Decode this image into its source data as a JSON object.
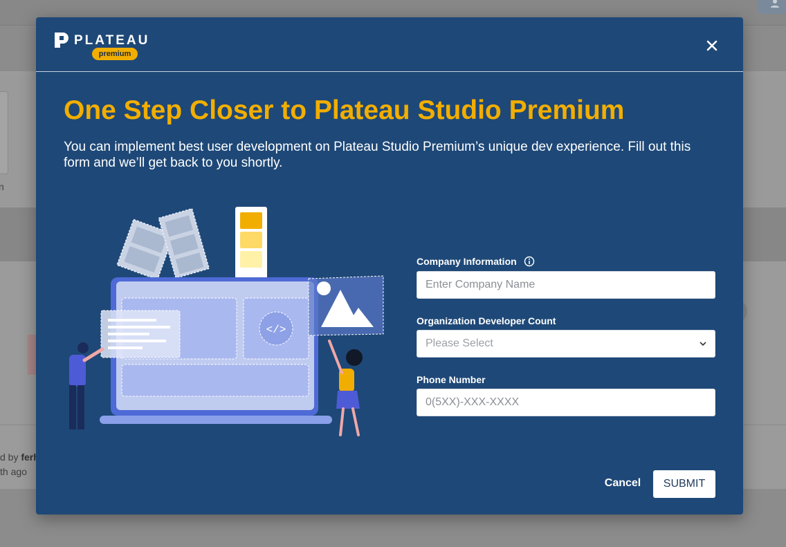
{
  "background": {
    "footer_by_prefix": "d by",
    "footer_by_name": "ferh",
    "footer_time": "th ago",
    "side_letter": "n"
  },
  "modal": {
    "logo": {
      "wordmark": "PLATEAU",
      "badge": "premium"
    },
    "close_icon": "close-icon",
    "title": "One Step Closer to Plateau Studio Premium",
    "subtitle": "You can implement best user development on Plateau Studio Premium’s unique dev experience. Fill out this form and we’ll get back to you shortly.",
    "form": {
      "company": {
        "label": "Company Information",
        "placeholder": "Enter Company Name",
        "value": ""
      },
      "developer_count": {
        "label": "Organization Developer Count",
        "selected": "Please Select"
      },
      "phone": {
        "label": "Phone Number",
        "placeholder": "0(5XX)-XXX-XXXX",
        "value": ""
      }
    },
    "actions": {
      "cancel_label": "Cancel",
      "submit_label": "SUBMIT"
    }
  },
  "colors": {
    "modal_bg": "#1e4877",
    "accent": "#f2ae00",
    "text": "#ffffff"
  }
}
